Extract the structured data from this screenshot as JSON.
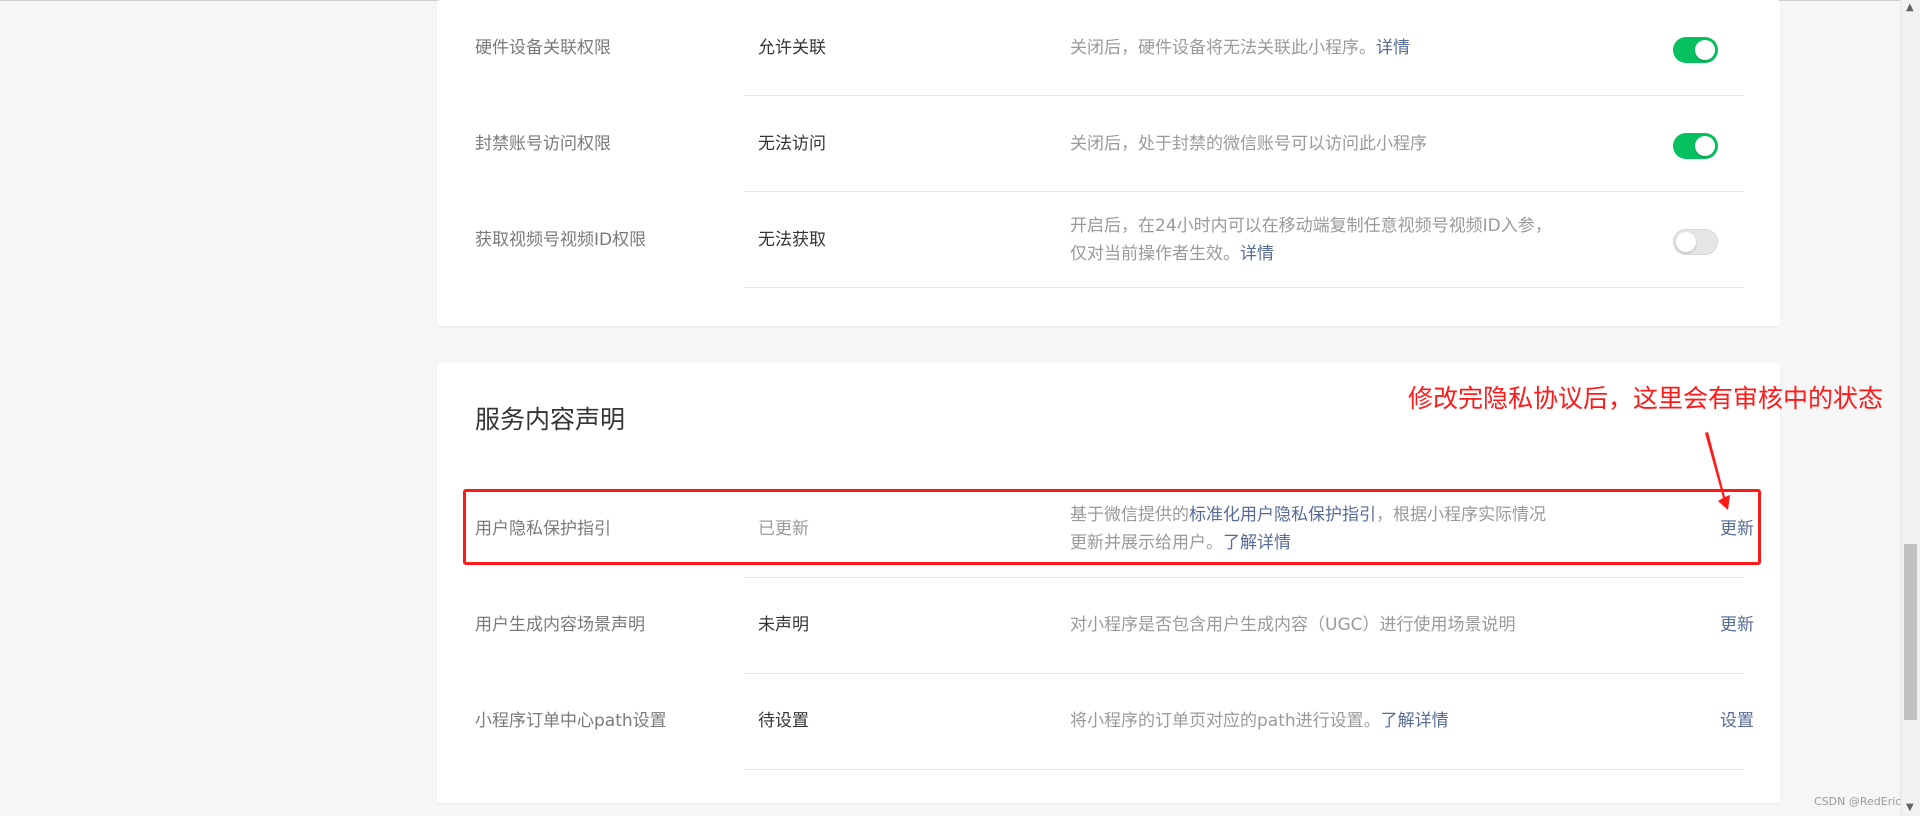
{
  "permissions_section": {
    "rows": [
      {
        "label": "硬件设备关联权限",
        "value": "允许关联",
        "desc": "关闭后，硬件设备将无法关联此小程序。",
        "desc_link": "详情",
        "toggle": "on"
      },
      {
        "label": "封禁账号访问权限",
        "value": "无法访问",
        "desc": "关闭后，处于封禁的微信账号可以访问此小程序",
        "toggle": "on"
      },
      {
        "label": "获取视频号视频ID权限",
        "value": "无法获取",
        "desc_line1": "开启后，在24小时内可以在移动端复制任意视频号视频ID入参，",
        "desc_line2": "仅对当前操作者生效。",
        "desc_link": "详情",
        "toggle": "off"
      }
    ]
  },
  "service_section": {
    "title": "服务内容声明",
    "rows": [
      {
        "label": "用户隐私保护指引",
        "value": "已更新",
        "desc_part1": "基于微信提供的",
        "desc_link1": "标准化用户隐私保护指引",
        "desc_part2": "，根据小程序实际情况",
        "desc_line2": "更新并展示给用户。",
        "desc_link2": "了解详情",
        "action": "更新"
      },
      {
        "label": "用户生成内容场景声明",
        "value": "未声明",
        "desc": "对小程序是否包含用户生成内容（UGC）进行使用场景说明",
        "action": "更新"
      },
      {
        "label": "小程序订单中心path设置",
        "value": "待设置",
        "desc": "将小程序的订单页对应的path进行设置。",
        "desc_link": "了解详情",
        "action": "设置"
      }
    ]
  },
  "annotation": {
    "text": "修改完隐私协议后，这里会有审核中的状态",
    "color": "#ff1a1a"
  },
  "colors": {
    "toggle_on": "#07c160",
    "link": "#576b95",
    "background": "#f6f6f6"
  },
  "watermark": "CSDN @RedEric"
}
